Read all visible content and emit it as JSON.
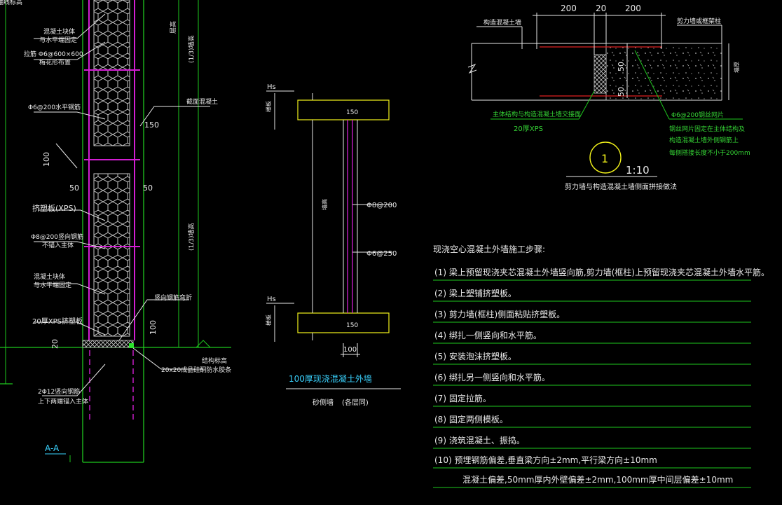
{
  "colors": {
    "background": "#000000",
    "wall_line": "#1ec81e",
    "xps_fill": "#c7c7c7",
    "rebar": "#d21ed2",
    "concrete_edge": "#f2f21a",
    "annotation": "#e8e8e8",
    "section_title": "#3ad3ff",
    "red_line": "#e02020"
  },
  "left_section": {
    "labels": [
      "轴线标高",
      "混凝土块体",
      "与水平端固定",
      "拉筋 Φ6@600×600",
      "梅花形布置",
      "Φ6@200水平钢筋",
      "截面混凝土",
      "挤塑板(XPS)",
      "Φ8@200竖向钢筋",
      "不锚入主体",
      "混凝土块体",
      "与水平端固定",
      "20厚XPS挤塑板",
      "竖向钢筋弯折",
      "20x20成品硅酮防水胶条",
      "2Φ12竖向钢筋",
      "上下两端锚入主体",
      "结构标高"
    ],
    "dims": [
      "150",
      "100",
      "50",
      "50",
      "100",
      "20"
    ],
    "vertical_dims": [
      "层高",
      "(1/3)墙高",
      "(1/3)墙高"
    ],
    "section_mark": "A-A"
  },
  "middle_section": {
    "hs_top": "Hs",
    "hs_bottom": "Hs",
    "slab_label": "楼板",
    "slab_width": "150",
    "bar_vertical": "Φ8@200",
    "bar_horizontal": "Φ6@250",
    "side_label": "墙高",
    "wall_thickness": "100",
    "title": "100厚现浇混凝土外墙",
    "subtitle": "砂侧墙",
    "subtitle_note": "(各层同)"
  },
  "top_right_detail": {
    "dims_top": [
      "200",
      "20",
      "200"
    ],
    "label_left": "构造混凝土墙",
    "label_right": "剪力墙或框架柱",
    "dim_50_a": "50",
    "dim_50_b": "50",
    "side_dim": "墙厚",
    "note_left_1": "主体结构与构造混凝土墙交接面",
    "note_left_2": "20厚XPS",
    "note_right": [
      "Φ6@200钢丝网片",
      "钢丝网片固定在主体结构及",
      "构造混凝土墙外侧钢筋上",
      "每侧搭接长度不小于200mm"
    ],
    "detail_number": "1",
    "scale": "1:10",
    "detail_title": "剪力墙与构造混凝土墙侧面拼接做法"
  },
  "steps": {
    "heading": "现浇空心混凝土外墙施工步骤:",
    "items": [
      "(1) 梁上预留现浇夹芯混凝土外墙竖向筋,剪力墙(框柱)上预留现浇夹芯混凝土外墙水平筋。",
      "(2) 梁上塑铺挤塑板。",
      "(3) 剪力墙(框柱)侧面粘贴挤塑板。",
      "(4) 绑扎一侧竖向和水平筋。",
      "(5) 安装泡沫挤塑板。",
      "(6) 绑扎另一侧竖向和水平筋。",
      "(7) 固定拉筋。",
      "(8) 固定两侧模板。",
      "(9) 浇筑混凝土、振捣。",
      "(10) 预埋钢筋偏差,垂直梁方向±2mm,平行梁方向±10mm"
    ],
    "tolerance_line": "混凝土偏差,50mm厚内外壁偏差±2mm,100mm厚中间层偏差±10mm"
  }
}
